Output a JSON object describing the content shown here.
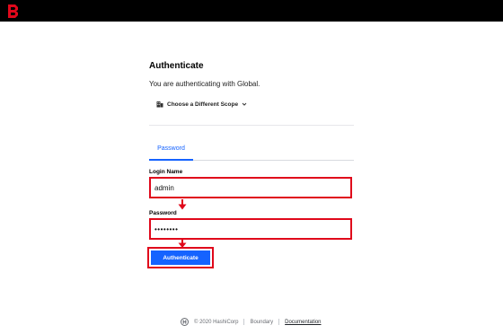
{
  "colors": {
    "topbar": "#000000",
    "brand": "#e0081b",
    "accent": "#1563ff",
    "annotation": "#e0081b"
  },
  "header": {
    "logo_icon": "boundary-logo-icon"
  },
  "auth": {
    "title": "Authenticate",
    "subtitle": "You are authenticating with Global.",
    "scope_label": "Choose a Different Scope",
    "tabs": [
      {
        "label": "Password",
        "active": true
      }
    ],
    "login_name": {
      "label": "Login Name",
      "value": "admin"
    },
    "password": {
      "label": "Password",
      "value": "••••••••"
    },
    "submit_label": "Authenticate"
  },
  "footer": {
    "copyright": "© 2020 HashiCorp",
    "product": "Boundary",
    "docs_link": "Documentation"
  }
}
